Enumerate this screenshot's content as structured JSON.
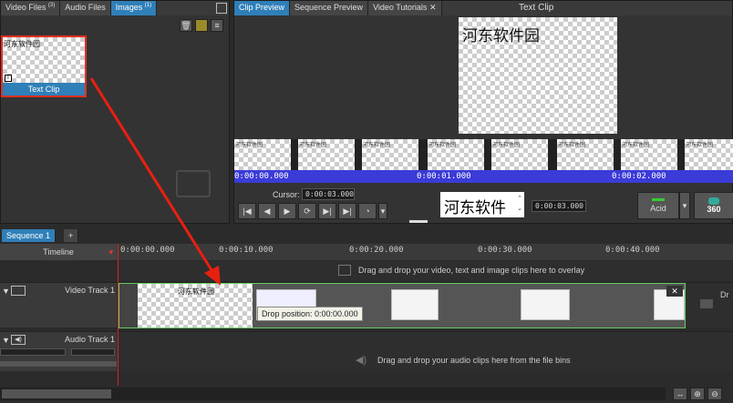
{
  "bins": {
    "tabs": [
      {
        "label": "Video Files",
        "sup": "(3)"
      },
      {
        "label": "Audio Files",
        "sup": ""
      },
      {
        "label": "Images",
        "sup": "(1)"
      }
    ],
    "clip": {
      "thumb_text": "河东软件园",
      "label": "Text Clip"
    }
  },
  "preview": {
    "tabs": [
      "Clip Preview",
      "Sequence Preview",
      "Video Tutorials"
    ],
    "title": "Text Clip",
    "screen_text": "河东软件园",
    "filmstrip_text": "河东软件园",
    "timecodes": [
      "0:00:00.000",
      "0:00:01.000",
      "0:00:02.000"
    ],
    "cursor_label": "Cursor:",
    "cursor_value": "0:00:03.000",
    "text_value": "河东软件",
    "duration_value": "0:00:03.000",
    "effect_label": "Acid",
    "vr_label": "360"
  },
  "sequence": {
    "tab": "Sequence 1",
    "add": "+",
    "timeline_label": "Timeline",
    "ruler": [
      "0:00:00.000",
      "0:00:10.000",
      "0:00:20.000",
      "0:00:30.000",
      "0:00:40.000"
    ],
    "overlay_hint": "Drag and drop your video, text and image clips here to overlay",
    "video_track": "Video Track 1",
    "audio_track": "Audio Track 1",
    "clip_text": "河东软件园",
    "drop_tooltip": "Drop position: 0:00:00.000",
    "audio_hint": "Drag and drop your audio clips here from the file bins",
    "right_cut": "Dr"
  }
}
